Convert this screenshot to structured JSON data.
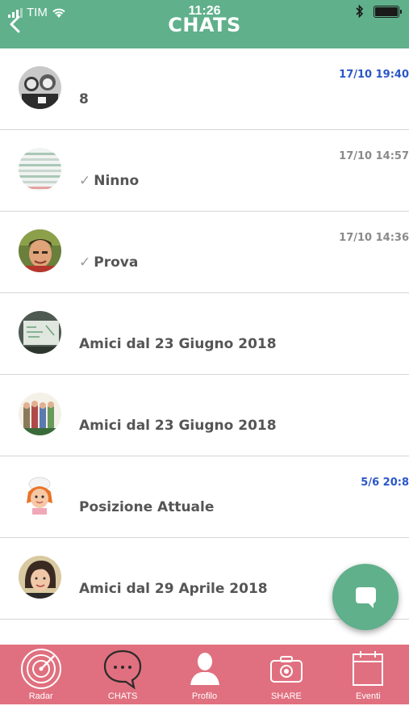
{
  "status_bar": {
    "carrier": "TIM",
    "time": "11:26"
  },
  "header": {
    "title": "CHATS"
  },
  "chats": [
    {
      "name": "8",
      "time": "17/10 19:40",
      "time_color": "#2a56c8",
      "tick": false,
      "avatar": "avatar-group-bw-icon"
    },
    {
      "name": "Ninno",
      "time": "17/10 14:57",
      "time_color": "#8a8a8a",
      "tick": true,
      "avatar": "avatar-blinds-icon"
    },
    {
      "name": "Prova",
      "time": "17/10 14:36",
      "time_color": "#8a8a8a",
      "tick": true,
      "avatar": "avatar-man-icon"
    },
    {
      "name": "Amici dal 23 Giugno 2018",
      "time": "",
      "time_color": "#8a8a8a",
      "tick": false,
      "avatar": "avatar-whiteboard-icon"
    },
    {
      "name": "Amici dal 23 Giugno 2018",
      "time": "",
      "time_color": "#8a8a8a",
      "tick": false,
      "avatar": "avatar-cartoon-group-icon"
    },
    {
      "name": "Posizione Attuale",
      "time": "5/6 20:8",
      "time_color": "#2a56c8",
      "tick": false,
      "avatar": "avatar-chef-girl-icon"
    },
    {
      "name": "Amici dal 29 Aprile 2018",
      "time": "",
      "time_color": "#8a8a8a",
      "tick": false,
      "avatar": "avatar-woman-icon"
    }
  ],
  "tabs": [
    {
      "label": "Radar",
      "icon": "radar-icon"
    },
    {
      "label": "CHATS",
      "icon": "chat-bubble-icon"
    },
    {
      "label": "Profilo",
      "icon": "profile-icon"
    },
    {
      "label": "SHARE",
      "icon": "camera-icon"
    },
    {
      "label": "Eventi",
      "icon": "calendar-icon"
    }
  ],
  "colors": {
    "header": "#5fb08b",
    "tabbar": "#e0707f",
    "accent_time": "#2a56c8"
  }
}
